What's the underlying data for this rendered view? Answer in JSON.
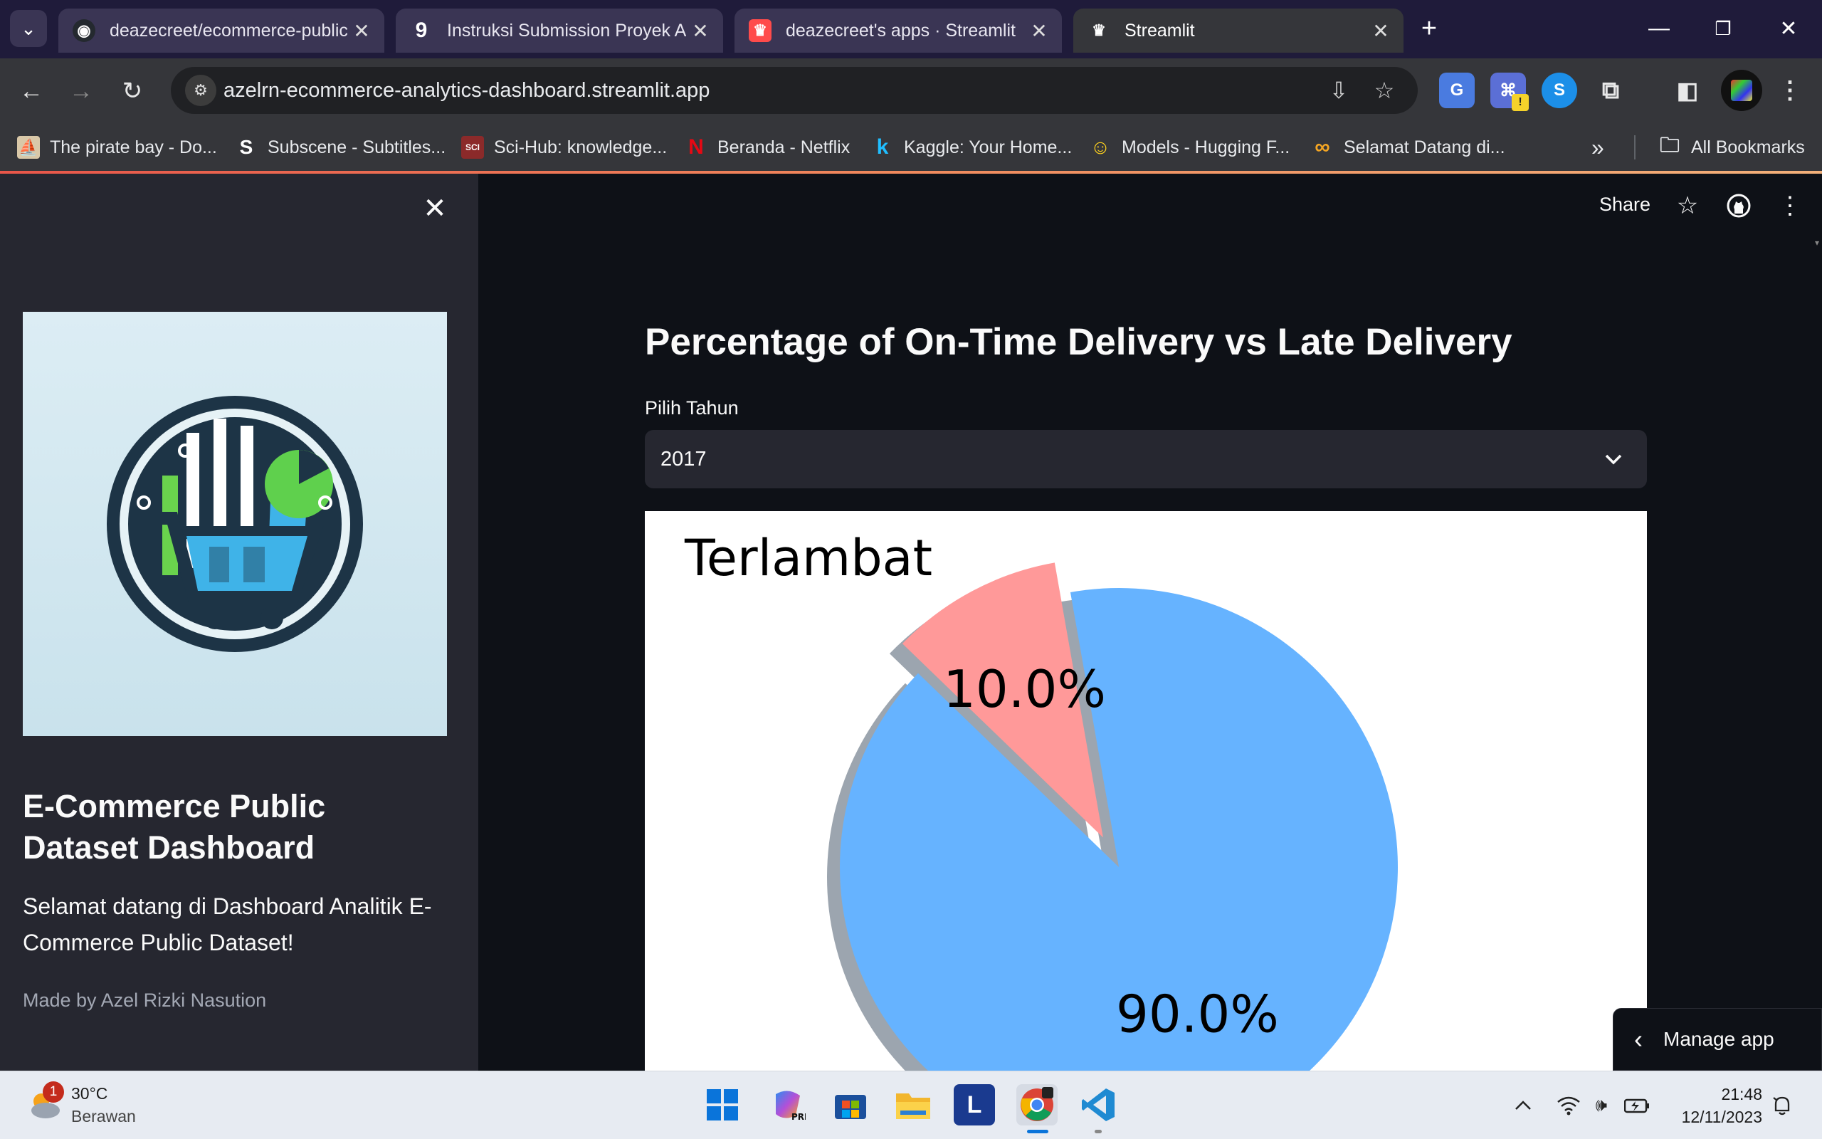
{
  "browser": {
    "tabs": [
      {
        "title": "deazecreet/ecommerce-public-",
        "favicon": "github-icon"
      },
      {
        "title": "Instruksi Submission Proyek An",
        "favicon": "dicoding-icon"
      },
      {
        "title": "deazecreet's apps · Streamlit",
        "favicon": "streamlit-icon"
      },
      {
        "title": "Streamlit",
        "favicon": "streamlit-icon",
        "active": true
      }
    ],
    "url": "azelrn-ecommerce-analytics-dashboard.streamlit.app",
    "bookmarks": [
      {
        "label": "The pirate bay - Do...",
        "icon": "pirate-ship-icon"
      },
      {
        "label": "Subscene - Subtitles...",
        "icon": "subscene-icon"
      },
      {
        "label": "Sci-Hub: knowledge...",
        "icon": "scihub-icon"
      },
      {
        "label": "Beranda - Netflix",
        "icon": "netflix-icon"
      },
      {
        "label": "Kaggle: Your Home...",
        "icon": "kaggle-icon"
      },
      {
        "label": "Models - Hugging F...",
        "icon": "hugging-face-icon"
      },
      {
        "label": "Selamat Datang di...",
        "icon": "infinity-icon"
      }
    ],
    "all_bookmarks": "All Bookmarks",
    "accent": "#1f1b3a"
  },
  "sidebar": {
    "title": "E-Commerce Public Dataset Dashboard",
    "text": "Selamat datang di Dashboard Analitik E-Commerce Public Dataset!",
    "caption": "Made by Azel Rizki Nasution"
  },
  "header": {
    "share": "Share"
  },
  "main": {
    "title": "Percentage of On-Time Delivery vs Late Delivery",
    "select_label": "Pilih Tahun",
    "select_value": "2017"
  },
  "manage_app": "Manage app",
  "chart_data": {
    "type": "pie",
    "slices": [
      {
        "label": "Terlambat",
        "value": 10.0,
        "pct_label": "10.0%",
        "color": "#ff9999",
        "exploded": true
      },
      {
        "label": "",
        "value": 90.0,
        "pct_label": "90.0%",
        "color": "#66b3ff"
      }
    ],
    "shadow": true
  },
  "taskbar": {
    "weather_temp": "30°C",
    "weather_desc": "Berawan",
    "weather_badge": "1",
    "time": "21:48",
    "date": "12/11/2023"
  }
}
